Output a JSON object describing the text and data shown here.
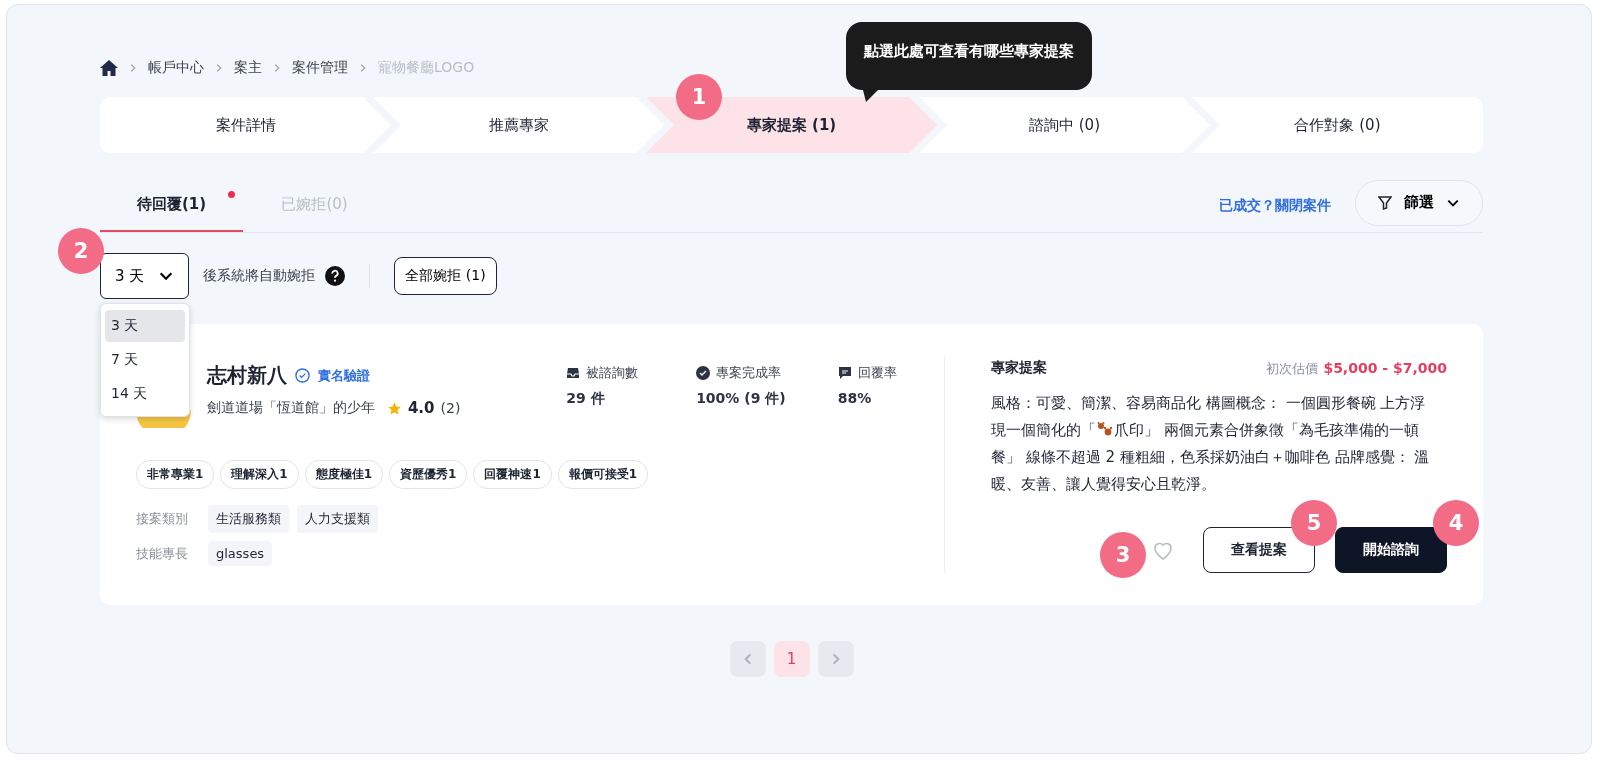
{
  "breadcrumb": [
    {
      "label": "帳戶中心",
      "current": false
    },
    {
      "label": "案主",
      "current": false
    },
    {
      "label": "案件管理",
      "current": false
    },
    {
      "label": "寵物餐廳LOGO",
      "current": true
    }
  ],
  "tooltip": {
    "text": "點選此處可查看有哪些專家提案"
  },
  "steps": [
    {
      "label": "案件詳情",
      "selected": false
    },
    {
      "label": "推薦專家",
      "selected": false
    },
    {
      "label": "專家提案 (1)",
      "selected": true
    },
    {
      "label": "諮詢中 (0)",
      "selected": false
    },
    {
      "label": "合作對象 (0)",
      "selected": false
    }
  ],
  "tabs": [
    {
      "label": "待回覆(1)",
      "selected": true,
      "dot": true
    },
    {
      "label": "已婉拒(0)",
      "selected": false,
      "dot": false
    }
  ],
  "close_case_link": "已成交？關閉案件",
  "filter_button": "篩選",
  "auto_reject": {
    "value": "3 天",
    "suffix": "後系統將自動婉拒",
    "expanded": true,
    "options": [
      {
        "label": "3 天",
        "selected": true
      },
      {
        "label": "7 天",
        "selected": false
      },
      {
        "label": "14 天",
        "selected": false
      }
    ]
  },
  "reject_all_button": "全部婉拒 (1)",
  "expert": {
    "name": "志村新八",
    "verified": "實名驗證",
    "title": "劍道道場「恆道館」的少年",
    "rating": "4.0",
    "reviews": "(2)",
    "stats": [
      {
        "label": "被諮詢數",
        "value": "29 件"
      },
      {
        "label": "專案完成率",
        "value": "100% (9 件)"
      },
      {
        "label": "回覆率",
        "value": "88%"
      }
    ],
    "tags": [
      "非常專業1",
      "理解深入1",
      "態度極佳1",
      "資歷優秀1",
      "回覆神速1",
      "報價可接受1"
    ],
    "details": [
      {
        "label": "接案類別",
        "values": [
          "生活服務類",
          "人力支援類"
        ]
      },
      {
        "label": "技能專長",
        "values": [
          "glasses"
        ]
      }
    ]
  },
  "proposal": {
    "heading": "專家提案",
    "estimate_label": "初次估價",
    "estimate": "$5,000 - $7,000",
    "text_before": "風格：可愛、簡潔、容易商品化  構圖概念： 一個圓形餐碗 上方浮現一個簡化的「",
    "text_after": "爪印」 兩個元素合併象徵「為毛孩準備的一頓餐」 線條不超過 2 種粗細，色系採奶油白＋咖啡色  品牌感覺： 溫暖、友善、讓人覺得安心且乾淨。",
    "favorited": false,
    "buttons": [
      {
        "label": "查看提案",
        "kind": "outline"
      },
      {
        "label": "開始諮詢",
        "kind": "primary"
      }
    ]
  },
  "markers": [
    "1",
    "2",
    "3",
    "4",
    "5"
  ],
  "pagination": {
    "pages": [
      {
        "label": "1",
        "selected": true
      }
    ]
  }
}
